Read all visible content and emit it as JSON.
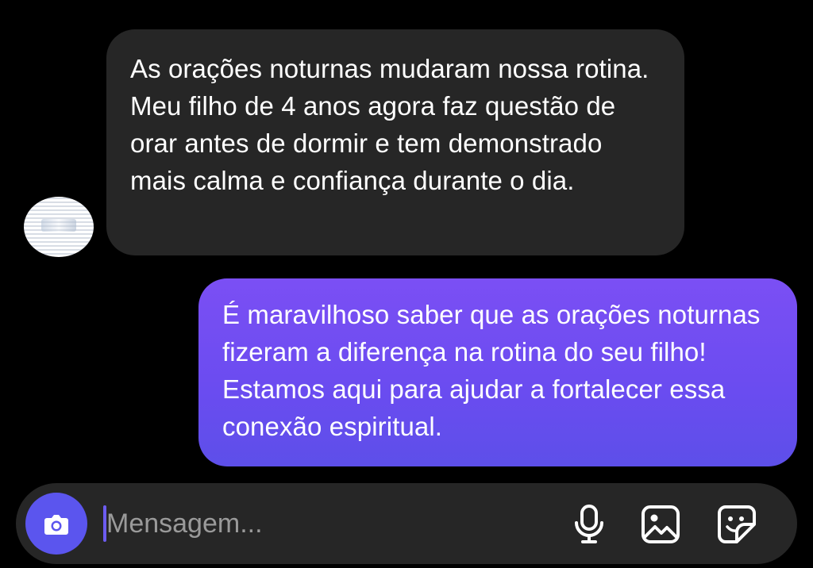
{
  "conversation": {
    "incoming_message": "As orações noturnas mudaram nossa rotina. Meu filho de 4 anos agora faz questão de orar antes de dormir e tem demonstrado mais calma e confiança durante o dia.",
    "outgoing_message": "É maravilhoso saber que as orações noturnas fizeram a diferença na rotina do seu filho! Estamos aqui para ajudar a fortalecer essa conexão espiritual."
  },
  "composer": {
    "placeholder": "Mensagem...",
    "value": "",
    "camera_icon": "camera-icon",
    "mic_icon": "microphone-icon",
    "gallery_icon": "image-gallery-icon",
    "sticker_icon": "sticker-icon"
  },
  "colors": {
    "background": "#000000",
    "incoming_bubble": "#262626",
    "outgoing_bubble": "#6a4cf0",
    "accent": "#5b55ee"
  }
}
